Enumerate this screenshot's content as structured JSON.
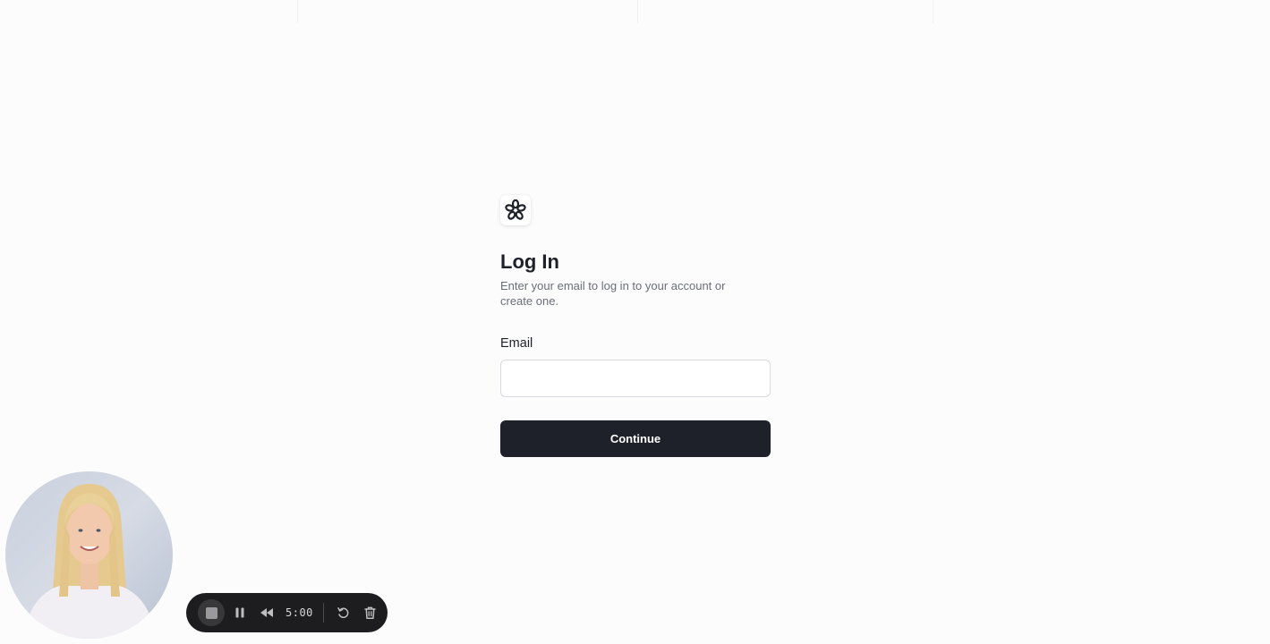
{
  "login": {
    "title": "Log In",
    "subtitle": "Enter your email to log in to your account or create one.",
    "email_label": "Email",
    "email_value": "",
    "email_placeholder": "",
    "continue_label": "Continue"
  },
  "icons": {
    "logo": "flower-logo-icon",
    "stop": "stop-icon",
    "pause": "pause-icon",
    "rewind": "rewind-icon",
    "restart": "restart-icon",
    "delete": "trash-icon"
  },
  "recorder": {
    "timer": "5:00"
  },
  "colors": {
    "primary": "#1f212a",
    "background": "#fcfcfc",
    "recorder_bar": "#1d1d1f"
  }
}
